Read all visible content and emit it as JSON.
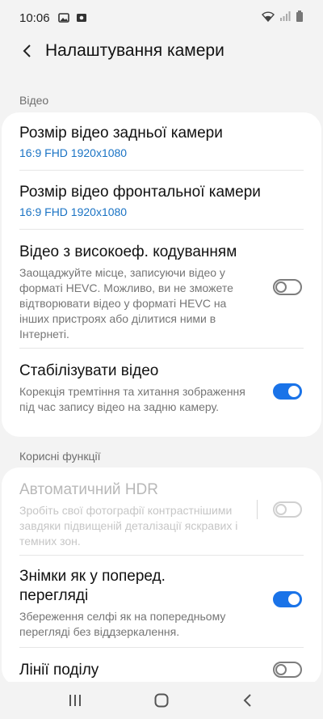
{
  "status_bar": {
    "time": "10:06",
    "icons": [
      "gallery-icon",
      "screenshot-icon",
      "wifi-icon",
      "signal-icon",
      "battery-icon"
    ]
  },
  "header": {
    "title": "Налаштування камери",
    "back_icon": "back-arrow-icon"
  },
  "sections": [
    {
      "header": "Відео",
      "items": [
        {
          "title": "Розмір відео задньої камери",
          "value": "16:9 FHD 1920x1080"
        },
        {
          "title": "Розмір відео фронтальної камери",
          "value": "16:9 FHD 1920x1080"
        },
        {
          "title": "Відео з високоеф. кодуванням",
          "description": "Заощаджуйте місце, записуючи відео у форматі HEVC. Можливо, ви не зможете відтворювати відео у форматі HEVC на інших пристроях або ділитися ними в Інтернеті.",
          "toggle": false
        },
        {
          "title": "Стабілізувати відео",
          "description": "Корекція тремтіння та хитання зображення під час запису відео на задню камеру.",
          "toggle": true
        }
      ]
    },
    {
      "header": "Корисні функції",
      "items": [
        {
          "title": "Автоматичний HDR",
          "description": "Зробіть свої фотографії контрастнішими завдяки підвищеній деталізації яскравих і темних зон.",
          "toggle": false,
          "disabled": true
        },
        {
          "title": "Знімки як у поперед. перегляді",
          "description": "Збереження селфі як на попередньому перегляді без віддзеркалення.",
          "toggle": true
        },
        {
          "title": "Лінії поділу",
          "toggle": false
        }
      ]
    }
  ],
  "nav_bar": {
    "buttons": [
      "recents-icon",
      "home-icon",
      "back-icon"
    ]
  },
  "colors": {
    "accent": "#1a73e8",
    "value_text": "#1a73c4",
    "background": "#f3f3f3",
    "card": "#ffffff"
  }
}
